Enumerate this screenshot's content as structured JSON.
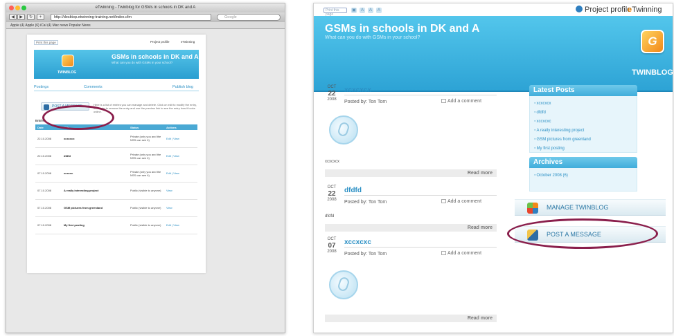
{
  "left": {
    "window_title": "eTwinning - Twinblog for GSMs in schools in DK and A",
    "url": "http://desktop.etwinning-training.net/index.cfm",
    "search_placeholder": "Google",
    "bookmarks": "Apple (4) Apple (6) iCal (4) Mac news Popular News",
    "print_page": "Print this page",
    "project_profile": "Project profile",
    "twinning": "eTwinning",
    "blog_title": "GSMs in schools in DK and A",
    "blog_subtitle": "What can you do with GSMs in your school?",
    "twinblog": "TWINBLOG",
    "tabs": {
      "left": "Postings",
      "comments": "Comments",
      "right": "Publish blog"
    },
    "post_button": "POST A MESSAGE",
    "info_text": "Here is a list of entries you can manage and delete. Click on edit to modify the entry, on delete to remove the entry and use the preview link to see the entry how it looks online.",
    "entries_label": "Entries",
    "table": {
      "headers": [
        "Date",
        "Title",
        "Status",
        "Actions"
      ],
      "rows": [
        {
          "date": "22.10.2008",
          "title": "xcxcxcx",
          "status": "Private (only you and the NSS can see it)",
          "actions": "Edit | View"
        },
        {
          "date": "22.10.2008",
          "title": "dfdfd",
          "status": "Private (only you and the NSS can see it)",
          "actions": "Edit | View"
        },
        {
          "date": "07.10.2008",
          "title": "xcxcxc",
          "status": "Private (only you and the NSS can see it)",
          "actions": "Edit | View"
        },
        {
          "date": "07.10.2008",
          "title": "A really interesting project",
          "status": "Public (visible to anyone)",
          "actions": "View"
        },
        {
          "date": "07.10.2008",
          "title": "GSM pictures from greenland",
          "status": "Public (visible to anyone)",
          "actions": "View"
        },
        {
          "date": "07.10.2008",
          "title": "My first posting",
          "status": "Public (visible to anyone)",
          "actions": "Edit | View"
        }
      ]
    }
  },
  "right": {
    "print_page": "Print this page",
    "project_profile": "Project profile",
    "twinning": "Twinning",
    "blog_title": "GSMs in schools in DK and A",
    "blog_subtitle": "What can you do with GSMs in your school?",
    "app_letter": "G",
    "twinblog": "TWINBLOG",
    "posts": [
      {
        "month": "OCT",
        "day": "22",
        "year": "2008",
        "title": "xcxcxcx",
        "posted_by": "Posted by: Ton Tom",
        "add_comment": "Add a comment",
        "excerpt": "xcxcxcx",
        "read_more": "Read more"
      },
      {
        "month": "OCT",
        "day": "22",
        "year": "2008",
        "title": "dfdfd",
        "posted_by": "Posted by: Ton Tom",
        "add_comment": "Add a comment",
        "excerpt": "dfdfd",
        "read_more": "Read more"
      },
      {
        "month": "OCT",
        "day": "07",
        "year": "2008",
        "title": "xccxcxc",
        "posted_by": "Posted by: Ton Tom",
        "add_comment": "Add a comment",
        "excerpt": "",
        "read_more": "Read more"
      }
    ],
    "sidebar": {
      "latest_title": "Latest Posts",
      "latest_items": [
        "xcxcxcx",
        "dfdfd",
        "xccxcxc",
        "A really interesting project",
        "GSM pictures from greenland",
        "My first posting"
      ],
      "archives_title": "Archives",
      "archive_items": [
        "October 2008 (6)"
      ]
    },
    "manage_button": "MANAGE TWINBLOG",
    "post_button": "POST A MESSAGE"
  },
  "colors": {
    "banner_blue": "#2da3d5",
    "link_blue": "#2a8fc4",
    "highlight_circle": "#8a1f4c",
    "app_orange": "#f28819"
  },
  "icons": [
    "pencil-icon",
    "globe-icon",
    "twinblog-app-icon",
    "comment-icon",
    "placeholder-image-icon"
  ]
}
